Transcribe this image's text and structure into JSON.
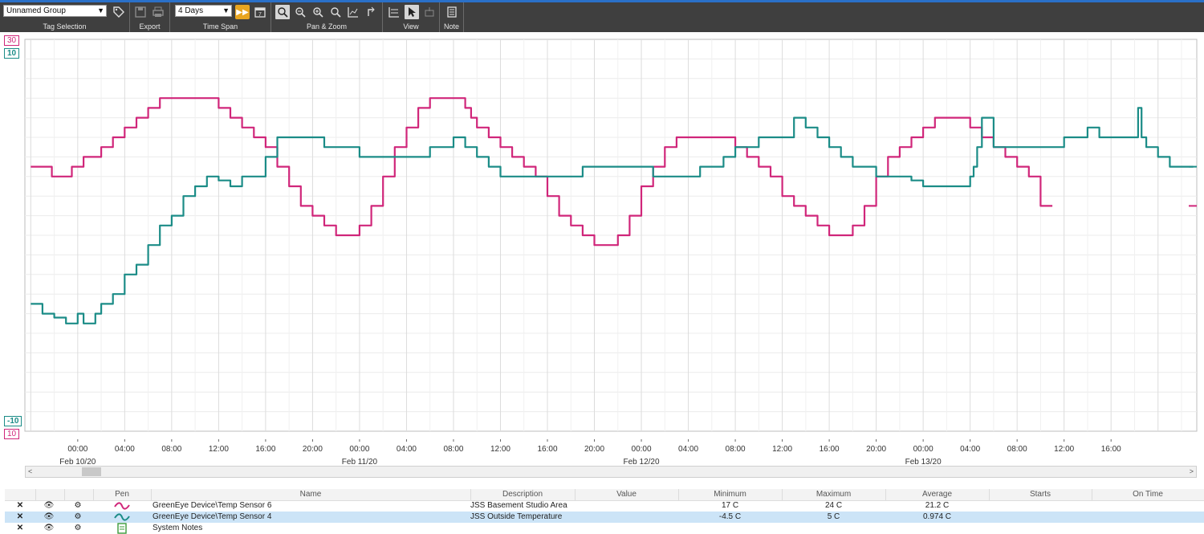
{
  "toolbar": {
    "group_select": "Unnamed Group",
    "timespan_select": "4 Days",
    "labels": {
      "tag_selection": "Tag Selection",
      "export": "Export",
      "time_span": "Time Span",
      "pan_zoom": "Pan & Zoom",
      "view": "View",
      "note": "Note"
    }
  },
  "scales": {
    "pink_top": "30",
    "teal_top": "10",
    "teal_bottom": "-10",
    "pink_bottom": "10"
  },
  "colors": {
    "pink": "#d0267a",
    "teal": "#1b8c87",
    "toolbar": "#3f3f3f"
  },
  "chart_data": {
    "type": "line",
    "x_tick_labels": [
      "00:00",
      "04:00",
      "08:00",
      "12:00",
      "16:00",
      "20:00",
      "00:00",
      "04:00",
      "08:00",
      "12:00",
      "16:00",
      "20:00",
      "00:00",
      "04:00",
      "08:00",
      "12:00",
      "16:00",
      "20:00",
      "00:00",
      "04:00",
      "08:00",
      "12:00",
      "16:00"
    ],
    "date_labels": [
      "Feb 10/20",
      "Feb 11/20",
      "Feb 12/20",
      "Feb 13/20"
    ],
    "series": [
      {
        "name": "GreenEye Device\\Temp Sensor 6",
        "color": "#d0267a",
        "ylim": [
          10,
          30
        ],
        "x_hours": [
          -4,
          -2.2,
          -0.5,
          0.5,
          2,
          3,
          4,
          5,
          6,
          7,
          8,
          9,
          10,
          12,
          13,
          14,
          15,
          16,
          17,
          18,
          19,
          20,
          21,
          22,
          23,
          24,
          25,
          26,
          27,
          28,
          29,
          30,
          31,
          32,
          33,
          33.5,
          34,
          35,
          36,
          37,
          38,
          39,
          40,
          41,
          42,
          43,
          44,
          45,
          46,
          47,
          48,
          49,
          50,
          51,
          52,
          53,
          54,
          55,
          56,
          57,
          58,
          59,
          60,
          61,
          62,
          63,
          64,
          66,
          67,
          68,
          69,
          70,
          71,
          72,
          73,
          74,
          75,
          76,
          77,
          78,
          79,
          80,
          81,
          82,
          83,
          84,
          85,
          86,
          87,
          88,
          89,
          90,
          91,
          92,
          93,
          94,
          95,
          95.3
        ],
        "values": [
          23.5,
          23,
          23.5,
          24,
          24.5,
          25,
          25.5,
          26,
          26.5,
          27,
          27,
          27,
          27,
          26.5,
          26,
          25.5,
          25,
          24.5,
          23.5,
          22.5,
          21.5,
          21,
          20.5,
          20,
          20,
          20.5,
          21.5,
          23,
          24.5,
          25.5,
          26.5,
          27,
          27,
          27,
          26.5,
          26,
          25.5,
          25,
          24.5,
          24,
          23.5,
          23,
          22,
          21,
          20.5,
          20,
          19.5,
          19.5,
          20,
          21,
          22.5,
          23.5,
          24.5,
          25,
          25,
          25,
          25,
          25,
          24.5,
          24,
          23.5,
          23,
          22,
          21.5,
          21,
          20.5,
          20,
          20.5,
          21.5,
          23,
          24,
          24.5,
          25,
          25.5,
          26,
          26,
          26,
          25.5,
          25,
          24.5,
          24,
          23.5,
          23,
          21.5
        ]
      },
      {
        "name": "GreenEye Device\\Temp Sensor 4",
        "color": "#1b8c87",
        "ylim": [
          -10,
          10
        ],
        "x_hours": [
          -4,
          -3.5,
          -3,
          -2,
          -1,
          0,
          0.5,
          1,
          1.5,
          2,
          3,
          4,
          5,
          6,
          7,
          8,
          9,
          10,
          11,
          12,
          13,
          14,
          15,
          16,
          17,
          18,
          19,
          20,
          21,
          22,
          23,
          24,
          25,
          26,
          27,
          28,
          29,
          30,
          31,
          32,
          33,
          34,
          35,
          36,
          37,
          38,
          39,
          40,
          41,
          42,
          43,
          44,
          45,
          46,
          47,
          48,
          49,
          50,
          51,
          52,
          53,
          53.5,
          54,
          55,
          56,
          57,
          58,
          59,
          60,
          61,
          62,
          63,
          64,
          65,
          66,
          67,
          68,
          69,
          70,
          71,
          72,
          73,
          74,
          75,
          76,
          76.3,
          76.6,
          77,
          78,
          79,
          80,
          81,
          82,
          83,
          84,
          85,
          86,
          87,
          88,
          89,
          90,
          90.3,
          90.6,
          91,
          92,
          93,
          94,
          95,
          95.3
        ],
        "values": [
          -3.5,
          -3.5,
          -4,
          -4.2,
          -4.5,
          -4,
          -4.5,
          -4.5,
          -4,
          -3.5,
          -3,
          -2,
          -1.5,
          -0.5,
          0.5,
          1,
          2,
          2.5,
          3,
          2.8,
          2.5,
          3,
          3,
          4,
          5,
          5,
          5,
          5,
          4.5,
          4.5,
          4.5,
          4,
          4,
          4,
          4,
          4,
          4,
          4.5,
          4.5,
          5,
          4.5,
          4,
          3.5,
          3,
          3,
          3,
          3,
          3,
          3,
          3,
          3.5,
          3.5,
          3.5,
          3.5,
          3.5,
          3.5,
          3,
          3,
          3,
          3,
          3.5,
          3.5,
          3.5,
          4,
          4.5,
          4.5,
          5,
          5,
          5,
          6,
          5.5,
          5,
          4.5,
          4,
          3.5,
          3.5,
          3,
          3,
          3,
          2.8,
          2.5,
          2.5,
          2.5,
          2.5,
          3,
          3.5,
          4.5,
          6,
          4.5,
          4.5,
          4.5,
          4.5,
          4.5,
          4.5,
          5,
          5,
          5.5,
          5,
          5,
          5,
          5,
          6.5,
          5,
          4.5,
          4,
          3.5,
          3.5
        ]
      }
    ],
    "x_range_hours": [
      -4.5,
      95.3
    ],
    "grid": true
  },
  "pens_table": {
    "headers": [
      "Pen",
      "Name",
      "Description",
      "Value",
      "Minimum",
      "Maximum",
      "Average",
      "Starts",
      "On Time"
    ],
    "rows": [
      {
        "name": "GreenEye Device\\Temp Sensor 6",
        "description": "JSS Basement Studio Area",
        "value": "",
        "minimum": "17 C",
        "maximum": "24 C",
        "average": "21.2 C",
        "starts": "",
        "on_time": "",
        "color": "#d0267a"
      },
      {
        "name": "GreenEye Device\\Temp Sensor 4",
        "description": "JSS Outside Temperature",
        "value": "",
        "minimum": "-4.5 C",
        "maximum": "5 C",
        "average": "0.974 C",
        "starts": "",
        "on_time": "",
        "color": "#1b8c87"
      },
      {
        "name": "System Notes",
        "description": "",
        "value": "",
        "minimum": "",
        "maximum": "",
        "average": "",
        "starts": "",
        "on_time": "",
        "color": "#3a9a3a"
      }
    ]
  }
}
